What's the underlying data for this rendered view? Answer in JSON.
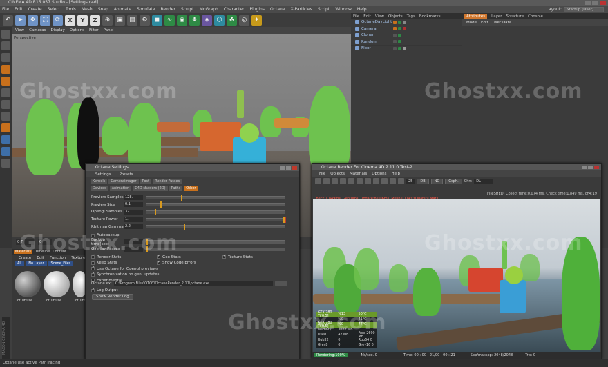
{
  "window": {
    "title": "CINEMA 4D R15.057 Studio - [Settings.c4d]"
  },
  "menubar": [
    "File",
    "Edit",
    "Create",
    "Select",
    "Tools",
    "Mesh",
    "Snap",
    "Animate",
    "Simulate",
    "Render",
    "Sculpt",
    "MoGraph",
    "Character",
    "Plugins",
    "Octane",
    "X-Particles",
    "Script",
    "Window",
    "Help"
  ],
  "layout": {
    "label": "Layout:",
    "value": "Startup (User)"
  },
  "viewport": {
    "menu": [
      "View",
      "Cameras",
      "Display",
      "Options",
      "Filter",
      "Panel"
    ],
    "label": "Perspective"
  },
  "objects": {
    "tabs": [
      "File",
      "Edit",
      "View",
      "Objects",
      "Tags",
      "Bookmarks"
    ],
    "items": [
      {
        "name": "OctaneDayLight"
      },
      {
        "name": "Camera"
      },
      {
        "name": "Cloner"
      },
      {
        "name": "Random"
      },
      {
        "name": "Floor"
      }
    ]
  },
  "attributes": {
    "tabs": [
      "Attributes",
      "Layer",
      "Structure",
      "Console"
    ],
    "menu": [
      "Mode",
      "Edit",
      "User Data"
    ]
  },
  "timeline": {
    "frame_start": "0 F",
    "frame_current": "0"
  },
  "materials": {
    "tabs": [
      "Materials",
      "Timeline",
      "Content"
    ],
    "menu": [
      "Create",
      "Edit",
      "Function",
      "Texture"
    ],
    "channels": [
      "All",
      "No Layer",
      "Scene_Files"
    ],
    "items": [
      {
        "name": "OctDiffuse"
      },
      {
        "name": "OctDiffuse"
      },
      {
        "name": "OctDiffuse"
      }
    ]
  },
  "octane_settings": {
    "title": "Octane Settings",
    "menu": [
      "Settings",
      "Presets"
    ],
    "tabs_row1": [
      "Kernels",
      "Cameraimager",
      "Post",
      "Render Passes"
    ],
    "tabs_row2": [
      "Devices",
      "Animation",
      "C4D shaders (2D)",
      "Paths",
      "Other"
    ],
    "params": [
      {
        "label": "Preview Samples",
        "value": "128.",
        "level": 0.25
      },
      {
        "label": "Preview Size",
        "value": "0.1",
        "level": 0.1
      },
      {
        "label": "Opengl Samples",
        "value": "32.",
        "level": 0.06
      },
      {
        "label": "Texture Power",
        "value": "1.",
        "level": 1.0
      },
      {
        "label": "Rbitmap Gamma",
        "value": "2.2",
        "level": 0.27
      }
    ],
    "autobackup": "Autobackup",
    "backup_time_label": "Backup time(sec)",
    "backup_time_value": "",
    "overlay_passes_label": "Overlay Passes",
    "overlay_passes_value": "",
    "checks_left": [
      {
        "label": "Render Stats",
        "checked": true
      },
      {
        "label": "Keep Stats",
        "checked": true
      },
      {
        "label": "Use Octane for Opengl previews",
        "checked": true
      },
      {
        "label": "Synchronization on gen. updates",
        "checked": true
      },
      {
        "label": "Experimental",
        "checked": false
      }
    ],
    "checks_mid": [
      {
        "label": "Geo Stats",
        "checked": true
      },
      {
        "label": "Show Code Errors",
        "checked": true
      }
    ],
    "checks_right": [
      {
        "label": "Texture Stats",
        "checked": true
      }
    ],
    "path_label": "Octane ex:",
    "path_value": "C:\\Program Files\\OTOY\\OctaneRender_2.11\\octane.exe",
    "log_output": "Log Output",
    "show_log_button": "Show Render Log"
  },
  "octane_render": {
    "title": "Octane Render For Cinema 4D 2.11.0 Test-2",
    "menu": [
      "File",
      "Objects",
      "Materials",
      "Options",
      "Help"
    ],
    "zoom": "25",
    "btns": [
      "DB",
      "NG",
      "Gsph."
    ],
    "chn_label": "Chn:",
    "chn_value": "DL",
    "finished": "[FINISHED] Collect time:0.074 ms. Check time:1.849 ms. ch4:19",
    "info": "Check:1.849ms. Gen:0ms. Update:8.006ms. Mesh:0 Loks:0 Mats:9 Mat:0",
    "stats": [
      [
        "GTX 780 Ti[0.5]",
        "%13",
        "50°C"
      ],
      [
        "",
        "%0",
        "41°C"
      ],
      [
        "GTX 780 Ti[0.5]",
        "%0",
        "77°C"
      ],
      [
        "Memory",
        "3072 MB",
        ""
      ],
      [
        "Used",
        "42 MB",
        "Free 2690 MB"
      ],
      [
        "Rgb32",
        "0",
        "Rgb64 0"
      ],
      [
        "Grey8",
        "0",
        "Grey16 0"
      ]
    ],
    "status_rendering": "Rendering:100%",
    "status_ms": "Ms/sec. 0",
    "status_time": "Time: 00 : 00 : 21/00 : 00 : 21",
    "status_spp": "Spp/maxspp: 2048/2048",
    "status_tris": "Tris: 0"
  },
  "statusbar": "Octane use active PathTracing",
  "watermark": "Ghostxx.com",
  "maxon": "MAXON CINEMA 4D"
}
